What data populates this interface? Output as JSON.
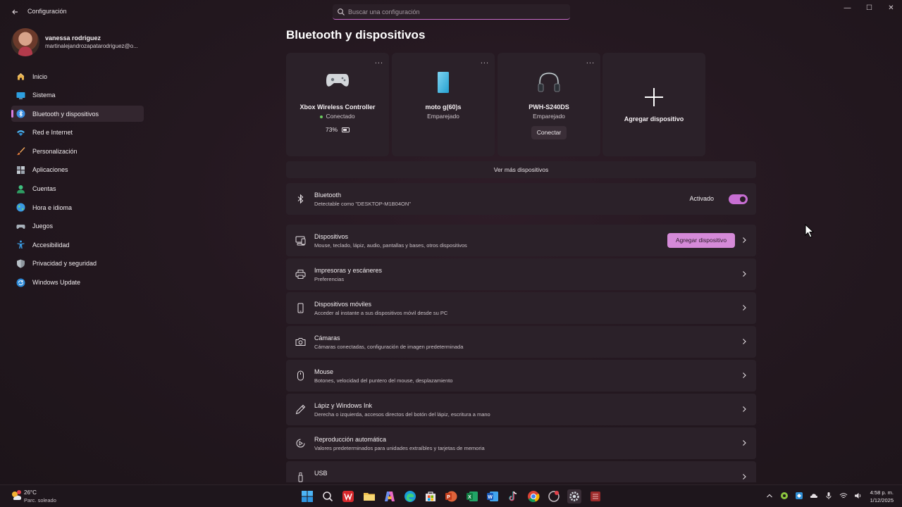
{
  "window": {
    "app_title": "Configuración",
    "search_placeholder": "Buscar una configuración",
    "controls": {
      "minimize": "—",
      "maximize": "☐",
      "close": "✕"
    }
  },
  "profile": {
    "name": "vanessa rodriguez",
    "email": "martinalejandrozapatarodriguez@o..."
  },
  "sidebar": {
    "items": [
      {
        "label": "Inicio",
        "icon": "home-icon",
        "selected": false
      },
      {
        "label": "Sistema",
        "icon": "system-icon",
        "selected": false
      },
      {
        "label": "Bluetooth y dispositivos",
        "icon": "bluetooth-icon",
        "selected": true
      },
      {
        "label": "Red e Internet",
        "icon": "wifi-icon",
        "selected": false
      },
      {
        "label": "Personalización",
        "icon": "brush-icon",
        "selected": false
      },
      {
        "label": "Aplicaciones",
        "icon": "apps-icon",
        "selected": false
      },
      {
        "label": "Cuentas",
        "icon": "account-icon",
        "selected": false
      },
      {
        "label": "Hora e idioma",
        "icon": "globe-icon",
        "selected": false
      },
      {
        "label": "Juegos",
        "icon": "gamepad-icon",
        "selected": false
      },
      {
        "label": "Accesibilidad",
        "icon": "accessibility-icon",
        "selected": false
      },
      {
        "label": "Privacidad y seguridad",
        "icon": "shield-icon",
        "selected": false
      },
      {
        "label": "Windows Update",
        "icon": "update-icon",
        "selected": false
      }
    ]
  },
  "main": {
    "title": "Bluetooth y dispositivos",
    "devices": [
      {
        "name": "Xbox Wireless Controller",
        "status": "Conectado",
        "battery": "73%",
        "icon": "gamepad-icon"
      },
      {
        "name": "moto g(60)s",
        "status": "Emparejado",
        "icon": "phone-icon"
      },
      {
        "name": "PWH-S240DS",
        "status": "Emparejado",
        "action": "Conectar",
        "icon": "headphones-icon"
      }
    ],
    "more_menu": "...",
    "add_device_card": "Agregar dispositivo",
    "see_more": "Ver más dispositivos",
    "bluetooth": {
      "title": "Bluetooth",
      "subtitle": "Detectable como \"DESKTOP-M1B04ON\"",
      "toggle_label": "Activado",
      "enabled": true
    },
    "rows": [
      {
        "title": "Dispositivos",
        "subtitle": "Mouse, teclado, lápiz, audio, pantallas y bases, otros dispositivos",
        "icon": "devices-icon",
        "button": "Agregar dispositivo"
      },
      {
        "title": "Impresoras y escáneres",
        "subtitle": "Preferencias",
        "icon": "printer-icon"
      },
      {
        "title": "Dispositivos móviles",
        "subtitle": "Acceder al instante a sus dispositivos móvil desde su PC",
        "icon": "mobile-icon"
      },
      {
        "title": "Cámaras",
        "subtitle": "Cámaras conectadas, configuración de imagen predeterminada",
        "icon": "camera-icon"
      },
      {
        "title": "Mouse",
        "subtitle": "Botones, velocidad del puntero del mouse, desplazamiento",
        "icon": "mouse-icon"
      },
      {
        "title": "Lápiz y Windows Ink",
        "subtitle": "Derecha o izquierda, accesos directos del botón del lápiz, escritura a mano",
        "icon": "pen-icon"
      },
      {
        "title": "Reproducción automática",
        "subtitle": "Valores predeterminados para unidades extraíbles y tarjetas de memoria",
        "icon": "autoplay-icon"
      },
      {
        "title": "USB",
        "subtitle": "",
        "icon": "usb-icon"
      }
    ]
  },
  "taskbar": {
    "weather_temp": "26°C",
    "weather_desc": "Parc. soleado",
    "apps": [
      "start-icon",
      "search-icon",
      "office-icon",
      "file-explorer-icon",
      "copilot-icon",
      "edge-icon",
      "store-icon",
      "powerpoint-icon",
      "excel-icon",
      "word-icon",
      "tiktok-icon",
      "chrome-icon",
      "app-icon",
      "settings-icon",
      "video-app-icon"
    ],
    "time": "4:58 p. m.",
    "date": "1/12/2025"
  },
  "colors": {
    "accent": "#c76ed2",
    "card_bg": "#2b2129",
    "page_bg": "#241820",
    "status_green": "#6ccb5f"
  }
}
